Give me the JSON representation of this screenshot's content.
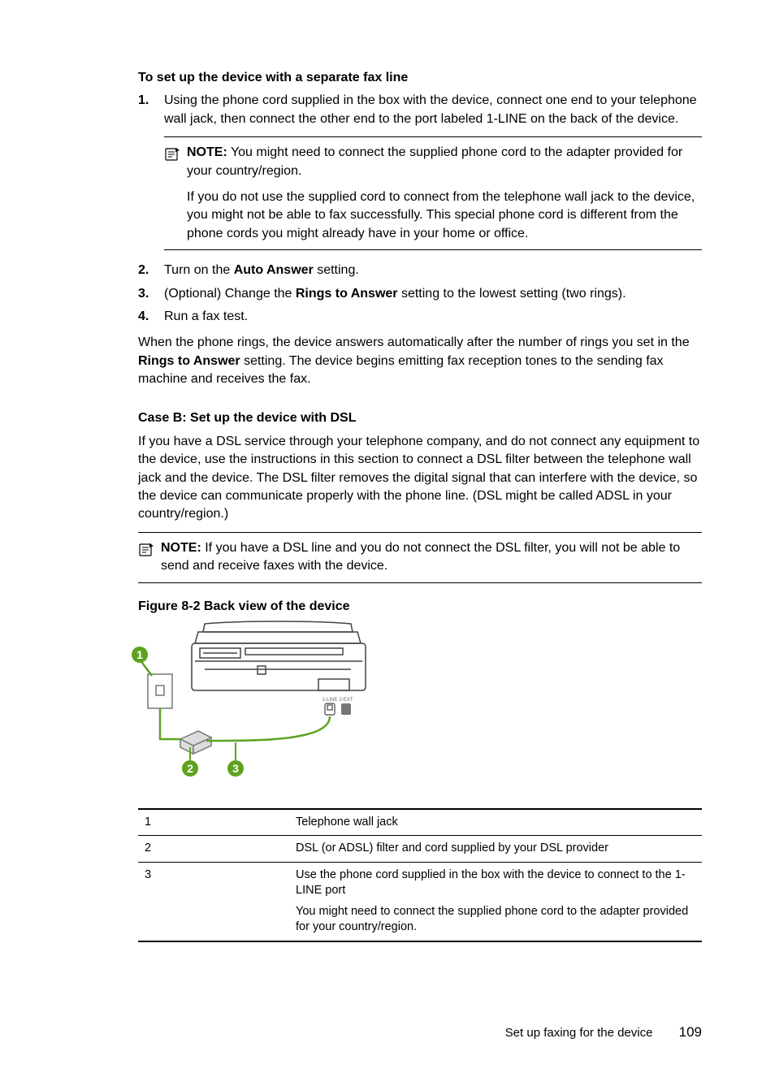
{
  "heading1": "To set up the device with a separate fax line",
  "steps": {
    "s1_num": "1.",
    "s1_text_a": "Using the phone cord supplied in the box with the device, connect one end to your telephone wall jack, then connect the other end to the port labeled 1-LINE on the back of the device.",
    "s2_num": "2.",
    "s2_text_a": "Turn on the ",
    "s2_bold": "Auto Answer",
    "s2_text_b": " setting.",
    "s3_num": "3.",
    "s3_text_a": "(Optional) Change the ",
    "s3_bold": "Rings to Answer",
    "s3_text_b": " setting to the lowest setting (two rings).",
    "s4_num": "4.",
    "s4_text": "Run a fax test."
  },
  "note1": {
    "label": "NOTE:",
    "p1": " You might need to connect the supplied phone cord to the adapter provided for your country/region.",
    "p2": "If you do not use the supplied cord to connect from the telephone wall jack to the device, you might not be able to fax successfully. This special phone cord is different from the phone cords you might already have in your home or office."
  },
  "para_after": {
    "a": "When the phone rings, the device answers automatically after the number of rings you set in the ",
    "b": "Rings to Answer",
    "c": " setting. The device begins emitting fax reception tones to the sending fax machine and receives the fax."
  },
  "heading2": "Case B: Set up the device with DSL",
  "para2": "If you have a DSL service through your telephone company, and do not connect any equipment to the device, use the instructions in this section to connect a DSL filter between the telephone wall jack and the device. The DSL filter removes the digital signal that can interfere with the device, so the device can communicate properly with the phone line. (DSL might be called ADSL in your country/region.)",
  "note2": {
    "label": "NOTE:",
    "text": " If you have a DSL line and you do not connect the DSL filter, you will not be able to send and receive faxes with the device."
  },
  "figure_caption": "Figure 8-2 Back view of the device",
  "figure_labels": {
    "port_left": "1-LINE",
    "port_right": "2-EXT"
  },
  "legend": {
    "k1": "1",
    "v1": "Telephone wall jack",
    "k2": "2",
    "v2": "DSL (or ADSL) filter and cord supplied by your DSL provider",
    "k3": "3",
    "v3a": "Use the phone cord supplied in the box with the device to connect to the 1-LINE port",
    "v3b": "You might need to connect the supplied phone cord to the adapter provided for your country/region."
  },
  "footer_text": "Set up faxing for the device",
  "page_number": "109"
}
